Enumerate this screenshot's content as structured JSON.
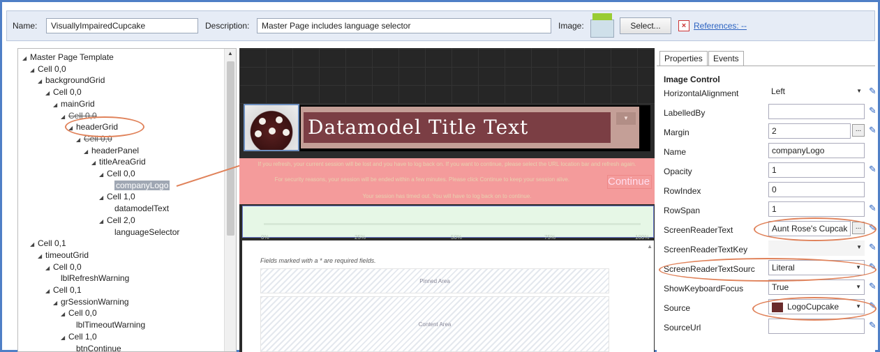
{
  "header": {
    "name_label": "Name:",
    "name_value": "VisuallyImpairedCupcake",
    "description_label": "Description:",
    "description_value": "Master Page includes language selector",
    "image_label": "Image:",
    "select_button": "Select...",
    "references_link": "References: --"
  },
  "tree": {
    "nodes": [
      {
        "label": "Master Page Template",
        "indent": 0
      },
      {
        "label": "Cell 0,0",
        "indent": 1
      },
      {
        "label": "backgroundGrid",
        "indent": 2
      },
      {
        "label": "Cell 0,0",
        "indent": 3
      },
      {
        "label": "mainGrid",
        "indent": 4
      },
      {
        "label": "Cell 0,0",
        "indent": 5
      },
      {
        "label": "headerGrid",
        "indent": 6
      },
      {
        "label": "Cell 0,0",
        "indent": 7
      },
      {
        "label": "headerPanel",
        "indent": 8
      },
      {
        "label": "titleAreaGrid",
        "indent": 9
      },
      {
        "label": "Cell 0,0",
        "indent": 10
      },
      {
        "label": "companyLogo",
        "indent": 11
      },
      {
        "label": "Cell 1,0",
        "indent": 10
      },
      {
        "label": "datamodelText",
        "indent": 11
      },
      {
        "label": "Cell 2,0",
        "indent": 10
      },
      {
        "label": "languageSelector",
        "indent": 11
      },
      {
        "label": "Cell 0,1",
        "indent": 1
      },
      {
        "label": "timeoutGrid",
        "indent": 2
      },
      {
        "label": "Cell 0,0",
        "indent": 3
      },
      {
        "label": "lblRefreshWarning",
        "indent": 4
      },
      {
        "label": "Cell 0,1",
        "indent": 3
      },
      {
        "label": "grSessionWarning",
        "indent": 4
      },
      {
        "label": "Cell 0,0",
        "indent": 5
      },
      {
        "label": "lblTimeoutWarning",
        "indent": 6
      },
      {
        "label": "Cell 1,0",
        "indent": 5
      },
      {
        "label": "btnContinue",
        "indent": 6
      }
    ]
  },
  "canvas": {
    "title_text": "Datamodel Title Text",
    "refresh_warning": "If you refresh, your current session will be lost and you have to log back on. If you want to continue, please select the URL location bar and refresh again.",
    "security_warning": "For security reasons, your session will be ended within a few minutes. Please click Continue to keep your session alive.",
    "timeout_warning": "Your session has timed out. You will have to log back on to continue.",
    "continue_label": "Continue",
    "progress_ticks": [
      "0%",
      "25%",
      "50%",
      "75%",
      "100%"
    ],
    "required_note": "Fields marked with a * are required fields.",
    "pinned_area": "Pinned Area",
    "content_area": "Content Area"
  },
  "properties": {
    "tabs": [
      "Properties",
      "Events"
    ],
    "section": "Image Control",
    "rows": [
      {
        "name": "HorizontalAlignment",
        "value": "Left"
      },
      {
        "name": "LabelledBy",
        "value": ""
      },
      {
        "name": "Margin",
        "value": "2"
      },
      {
        "name": "Name",
        "value": "companyLogo"
      },
      {
        "name": "Opacity",
        "value": "1"
      },
      {
        "name": "RowIndex",
        "value": "0"
      },
      {
        "name": "RowSpan",
        "value": "1"
      },
      {
        "name": "ScreenReaderText",
        "value": "Aunt Rose's Cupcak"
      },
      {
        "name": "ScreenReaderTextKey",
        "value": ""
      },
      {
        "name": "ScreenReaderTextSourc",
        "value": "Literal"
      },
      {
        "name": "ShowKeyboardFocus",
        "value": "True"
      },
      {
        "name": "Source",
        "value": "LogoCupcake"
      },
      {
        "name": "SourceUrl",
        "value": ""
      }
    ]
  },
  "colors": {
    "accent": "#4f7fc6",
    "highlight_circle": "#e0825a",
    "title_bg": "#7b3e44",
    "warning_bg": "#f49b9b"
  }
}
